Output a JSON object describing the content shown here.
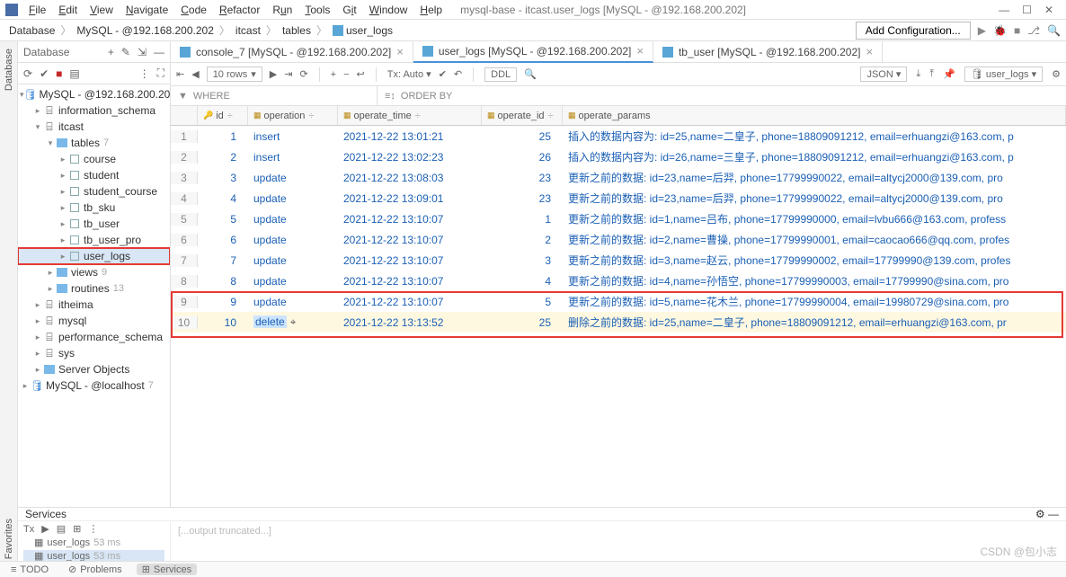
{
  "menubar": {
    "items": [
      "File",
      "Edit",
      "View",
      "Navigate",
      "Code",
      "Refactor",
      "Run",
      "Tools",
      "Git",
      "Window",
      "Help"
    ],
    "title": "mysql-base - itcast.user_logs [MySQL - @192.168.200.202]"
  },
  "breadcrumb": {
    "items": [
      "Database",
      "MySQL - @192.168.200.202",
      "itcast",
      "tables",
      "user_logs"
    ],
    "config_btn": "Add Configuration..."
  },
  "db_panel": {
    "title": "Database"
  },
  "tree": {
    "root1": "MySQL - @192.168.200.202",
    "schemas": {
      "info": "information_schema",
      "itcast": {
        "name": "itcast",
        "tables_label": "tables",
        "tables_count": "7",
        "tables": [
          "course",
          "student",
          "student_course",
          "tb_sku",
          "tb_user",
          "tb_user_pro",
          "user_logs"
        ],
        "views_label": "views",
        "views_count": "9",
        "routines_label": "routines",
        "routines_count": "13"
      },
      "others": [
        "itheima",
        "mysql",
        "performance_schema",
        "sys",
        "Server Objects"
      ]
    },
    "root2": "MySQL - @localhost",
    "root2_count": "7"
  },
  "tabs": [
    {
      "label": "console_7 [MySQL - @192.168.200.202]",
      "active": false
    },
    {
      "label": "user_logs [MySQL - @192.168.200.202]",
      "active": true
    },
    {
      "label": "tb_user [MySQL - @192.168.200.202]",
      "active": false
    }
  ],
  "grid_toolbar": {
    "rows": "10 rows",
    "tx": "Tx: Auto",
    "ddl": "DDL",
    "json": "JSON",
    "target": "user_logs"
  },
  "filter": {
    "where": "WHERE",
    "orderby": "ORDER BY"
  },
  "columns": [
    "id",
    "operation",
    "operate_time",
    "operate_id",
    "operate_params"
  ],
  "rows": [
    {
      "n": "1",
      "id": "1",
      "operation": "insert",
      "time": "2021-12-22 13:01:21",
      "opid": "25",
      "params": "插入的数据内容为: id=25,name=二皇子, phone=18809091212, email=erhuangzi@163.com, p"
    },
    {
      "n": "2",
      "id": "2",
      "operation": "insert",
      "time": "2021-12-22 13:02:23",
      "opid": "26",
      "params": "插入的数据内容为: id=26,name=三皇子, phone=18809091212, email=erhuangzi@163.com, p"
    },
    {
      "n": "3",
      "id": "3",
      "operation": "update",
      "time": "2021-12-22 13:08:03",
      "opid": "23",
      "params": "更新之前的数据: id=23,name=后羿, phone=17799990022, email=altycj2000@139.com, pro"
    },
    {
      "n": "4",
      "id": "4",
      "operation": "update",
      "time": "2021-12-22 13:09:01",
      "opid": "23",
      "params": "更新之前的数据: id=23,name=后羿, phone=17799990022, email=altycj2000@139.com, pro"
    },
    {
      "n": "5",
      "id": "5",
      "operation": "update",
      "time": "2021-12-22 13:10:07",
      "opid": "1",
      "params": "更新之前的数据: id=1,name=吕布, phone=17799990000, email=lvbu666@163.com, profess"
    },
    {
      "n": "6",
      "id": "6",
      "operation": "update",
      "time": "2021-12-22 13:10:07",
      "opid": "2",
      "params": "更新之前的数据: id=2,name=曹操, phone=17799990001, email=caocao666@qq.com, profes"
    },
    {
      "n": "7",
      "id": "7",
      "operation": "update",
      "time": "2021-12-22 13:10:07",
      "opid": "3",
      "params": "更新之前的数据: id=3,name=赵云, phone=17799990002, email=17799990@139.com, profes"
    },
    {
      "n": "8",
      "id": "8",
      "operation": "update",
      "time": "2021-12-22 13:10:07",
      "opid": "4",
      "params": "更新之前的数据: id=4,name=孙悟空, phone=17799990003, email=17799990@sina.com, pro"
    },
    {
      "n": "9",
      "id": "9",
      "operation": "update",
      "time": "2021-12-22 13:10:07",
      "opid": "5",
      "params": "更新之前的数据: id=5,name=花木兰, phone=17799990004, email=19980729@sina.com, pro"
    },
    {
      "n": "10",
      "id": "10",
      "operation": "delete",
      "time": "2021-12-22 13:13:52",
      "opid": "25",
      "params": "删除之前的数据: id=25,name=二皇子, phone=18809091212, email=erhuangzi@163.com, pr"
    }
  ],
  "services": {
    "title": "Services",
    "item1": "user_logs",
    "item1_t": "53 ms",
    "item2": "user_logs",
    "item2_t": "53 ms"
  },
  "statusbar": {
    "todo": "TODO",
    "problems": "Problems",
    "services": "Services"
  },
  "watermark": "CSDN @包小志"
}
